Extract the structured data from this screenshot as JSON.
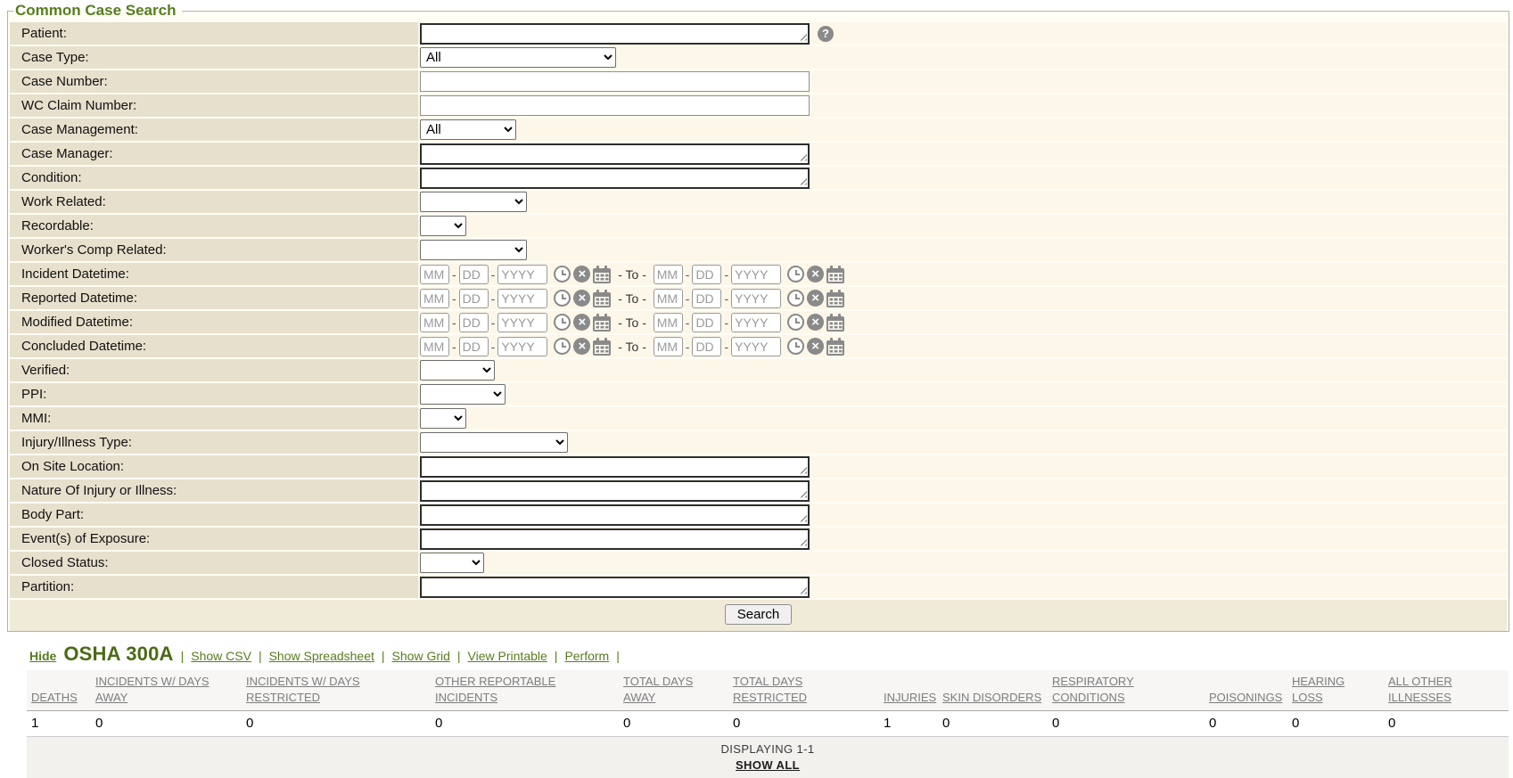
{
  "colors": {
    "accent_green": "#567d1e",
    "title_green": "#4a6b15",
    "label_bg": "#e7e0cd",
    "row_bg": "#fcf7e9"
  },
  "form": {
    "legend": "Common Case Search",
    "search_button": "Search",
    "datetime": {
      "mm": "MM",
      "dd": "DD",
      "yyyy": "YYYY",
      "separator": "-",
      "to": " - To - "
    },
    "rows": [
      {
        "label": "Patient:",
        "type": "autocomplete"
      },
      {
        "label": "Case Type:",
        "type": "select",
        "value": "All"
      },
      {
        "label": "Case Number:",
        "type": "text",
        "value": ""
      },
      {
        "label": "WC Claim Number:",
        "type": "text",
        "value": ""
      },
      {
        "label": "Case Management:",
        "type": "select",
        "value": "All"
      },
      {
        "label": "Case Manager:",
        "type": "autocomplete"
      },
      {
        "label": "Condition:",
        "type": "autocomplete"
      },
      {
        "label": "Work Related:",
        "type": "select",
        "value": ""
      },
      {
        "label": "Recordable:",
        "type": "select",
        "value": ""
      },
      {
        "label": "Worker's Comp Related:",
        "type": "select",
        "value": ""
      },
      {
        "label": "Incident Datetime:",
        "type": "datetime"
      },
      {
        "label": "Reported Datetime:",
        "type": "datetime"
      },
      {
        "label": "Modified Datetime:",
        "type": "datetime"
      },
      {
        "label": "Concluded Datetime:",
        "type": "datetime"
      },
      {
        "label": "Verified:",
        "type": "select",
        "value": ""
      },
      {
        "label": "PPI:",
        "type": "select",
        "value": ""
      },
      {
        "label": "MMI:",
        "type": "select",
        "value": ""
      },
      {
        "label": "Injury/Illness Type:",
        "type": "select",
        "value": ""
      },
      {
        "label": "On Site Location:",
        "type": "autocomplete"
      },
      {
        "label": "Nature Of Injury or Illness:",
        "type": "autocomplete"
      },
      {
        "label": "Body Part:",
        "type": "autocomplete"
      },
      {
        "label": "Event(s) of Exposure:",
        "type": "autocomplete"
      },
      {
        "label": "Closed Status:",
        "type": "select",
        "value": ""
      },
      {
        "label": "Partition:",
        "type": "autocomplete"
      }
    ]
  },
  "results": {
    "hide_label": "Hide",
    "title": "OSHA 300A",
    "separator": "|",
    "links": [
      "Show CSV",
      "Show Spreadsheet",
      "Show Grid",
      "View Printable",
      "Perform"
    ],
    "table": {
      "columns": [
        "DEATHS",
        "INCIDENTS W/ DAYS AWAY",
        "INCIDENTS W/ DAYS RESTRICTED",
        "OTHER REPORTABLE INCIDENTS",
        "TOTAL DAYS AWAY",
        "TOTAL DAYS RESTRICTED",
        "INJURIES",
        "SKIN DISORDERS",
        "RESPIRATORY CONDITIONS",
        "POISONINGS",
        "HEARING LOSS",
        "ALL OTHER ILLNESSES"
      ],
      "rows": [
        [
          "1",
          "0",
          "0",
          "0",
          "0",
          "0",
          "1",
          "0",
          "0",
          "0",
          "0",
          "0"
        ]
      ]
    },
    "displaying": "DISPLAYING 1-1",
    "show_all": "SHOW ALL"
  }
}
